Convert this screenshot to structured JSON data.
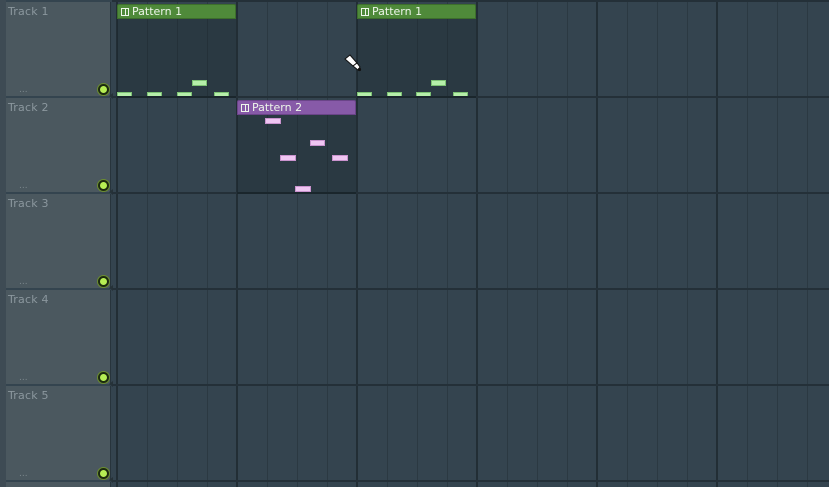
{
  "tracks": [
    {
      "name": "Track 1",
      "dots": "..."
    },
    {
      "name": "Track 2",
      "dots": "..."
    },
    {
      "name": "Track 3",
      "dots": "..."
    },
    {
      "name": "Track 4",
      "dots": "..."
    },
    {
      "name": "Track 5",
      "dots": "..."
    }
  ],
  "patterns": [
    {
      "label": "Pattern 1",
      "track": 1,
      "color": "#4f8a3a"
    },
    {
      "label": "Pattern 2",
      "track": 2,
      "color": "#875aa8"
    },
    {
      "label": "Pattern 1",
      "track": 1,
      "color": "#4f8a3a"
    }
  ],
  "icons": {
    "pattern_clip": "pattern-clip-icon",
    "mute": "mute-led-icon",
    "cursor": "paint-brush-cursor-icon"
  },
  "colors": {
    "background": "#34444f",
    "track_header": "#4b585f",
    "pattern1": "#4f8a3a",
    "pattern2": "#875aa8",
    "note_green": "#b6efaa",
    "note_purple": "#efc6f2",
    "mute_led": "#b6ee54"
  }
}
